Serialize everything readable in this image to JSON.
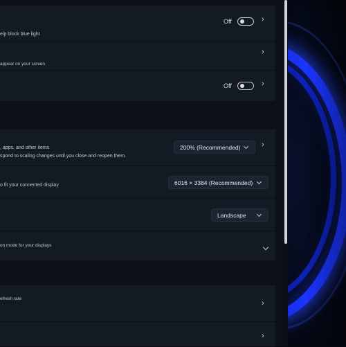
{
  "night_light": {
    "subtitle": "elp block blue light",
    "state_label": "Off"
  },
  "hdr": {
    "subtitle": "appear on your screen"
  },
  "third_toggle": {
    "state_label": "Off"
  },
  "scale": {
    "subtitle_line1": ", apps, and other items",
    "subtitle_line2": "spond to scaling changes until you close and reopen them.",
    "selected": "200% (Recommended)"
  },
  "resolution": {
    "subtitle": "o fit your connected display",
    "selected": "6016 × 3384 (Recommended)"
  },
  "orientation": {
    "selected": "Landscape"
  },
  "multiple_displays": {
    "subtitle": "on mode for your displays"
  },
  "refresh": {
    "subtitle": "efresh rate"
  },
  "colors": {
    "accent": "#1a35ff",
    "window_bg": "#0c1119",
    "card_bg": "#141a24"
  }
}
